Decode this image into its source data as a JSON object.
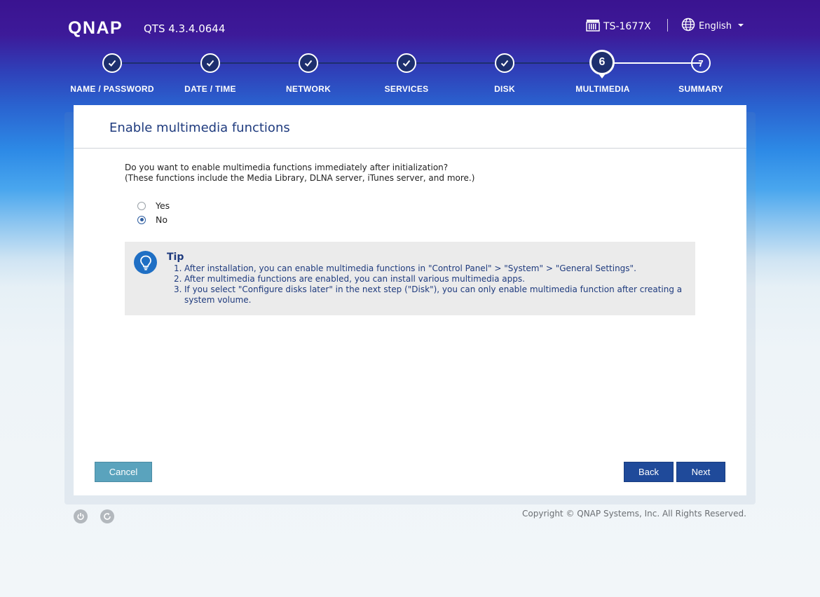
{
  "header": {
    "logo": "QNAP",
    "version": "QTS 4.3.4.0644",
    "model": "TS-1677X",
    "language": "English"
  },
  "stepper": {
    "steps": [
      {
        "label": "NAME / PASSWORD",
        "state": "done"
      },
      {
        "label": "DATE / TIME",
        "state": "done"
      },
      {
        "label": "NETWORK",
        "state": "done"
      },
      {
        "label": "SERVICES",
        "state": "done"
      },
      {
        "label": "DISK",
        "state": "done"
      },
      {
        "label": "MULTIMEDIA",
        "state": "current",
        "number": "6"
      },
      {
        "label": "SUMMARY",
        "state": "upcoming",
        "number": "7"
      }
    ]
  },
  "panel": {
    "title": "Enable multimedia functions",
    "question_line1": "Do you want to enable multimedia functions immediately after initialization?",
    "question_line2": "(These functions include the Media Library, DLNA server, iTunes server, and more.)",
    "options": [
      {
        "label": "Yes",
        "checked": false
      },
      {
        "label": "No",
        "checked": true
      }
    ],
    "tip": {
      "title": "Tip",
      "items": [
        {
          "num": "1.",
          "text": "After installation, you can enable multimedia functions in \"Control Panel\" > \"System\" > \"General Settings\"."
        },
        {
          "num": "2.",
          "text": "After multimedia functions are enabled, you can install various multimedia apps."
        },
        {
          "num": "3.",
          "text": "If you select \"Configure disks later\" in the next step (\"Disk\"), you can only enable multimedia function after creating a system volume."
        }
      ]
    },
    "buttons": {
      "cancel": "Cancel",
      "back": "Back",
      "next": "Next"
    }
  },
  "footer": {
    "copyright": "Copyright © QNAP Systems, Inc. All Rights Reserved."
  },
  "colors": {
    "step_fill": "#1d2f6e",
    "title_blue": "#1f3b7e",
    "primary_button": "#1f4a9a",
    "cancel_button": "#5aa3bd",
    "tip_icon": "#1f6fc4"
  }
}
